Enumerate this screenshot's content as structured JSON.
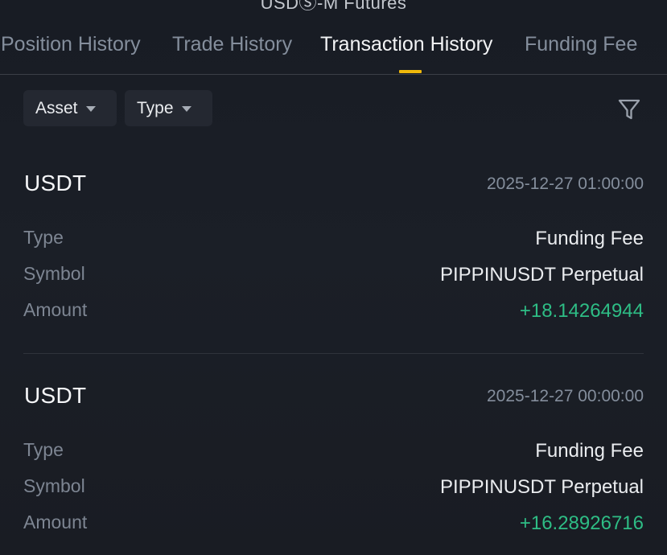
{
  "header": {
    "title": "USDⓈ-M Futures"
  },
  "tabs": [
    {
      "label": "Position History",
      "active": false
    },
    {
      "label": "Trade History",
      "active": false
    },
    {
      "label": "Transaction History",
      "active": true
    },
    {
      "label": "Funding Fee",
      "active": false
    }
  ],
  "filters": {
    "asset_label": "Asset",
    "type_label": "Type",
    "filter_icon": "funnel-icon"
  },
  "labels": {
    "type": "Type",
    "symbol": "Symbol",
    "amount": "Amount"
  },
  "transactions": [
    {
      "asset": "USDT",
      "time": "2025-12-27 01:00:00",
      "type": "Funding Fee",
      "symbol": "PIPPINUSDT Perpetual",
      "amount": "+18.14264944"
    },
    {
      "asset": "USDT",
      "time": "2025-12-27 00:00:00",
      "type": "Funding Fee",
      "symbol": "PIPPINUSDT Perpetual",
      "amount": "+16.28926716"
    }
  ],
  "colors": {
    "background": "#181a20",
    "accent": "#f0b90b",
    "positive": "#2ebd85",
    "muted": "#848e9c"
  }
}
